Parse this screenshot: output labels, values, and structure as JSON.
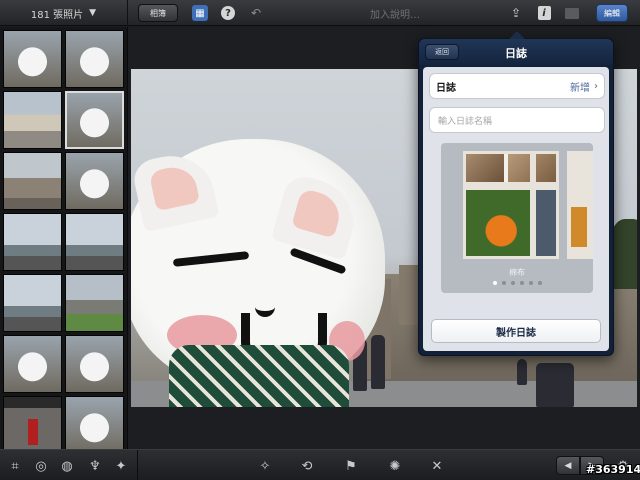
{
  "topbar": {
    "photo_count": "181 張照片",
    "count_arrow": "▼",
    "album_button": "相簿",
    "caption_placeholder": "加入說明…",
    "edit_button": "編輯",
    "icons": {
      "grid": "grid-icon",
      "help": "help-icon",
      "undo": "undo-icon",
      "share": "share-icon",
      "info": "info-icon",
      "compare": "compare-icon"
    },
    "glyphs": {
      "grid": "▦",
      "help": "?",
      "undo": "↶",
      "share": "⇪",
      "info": "i"
    }
  },
  "sidebar": {
    "thumbnails": [
      {
        "kind": "cat",
        "selected": false
      },
      {
        "kind": "cat",
        "selected": false
      },
      {
        "kind": "street",
        "selected": false
      },
      {
        "kind": "cat",
        "selected": true
      },
      {
        "kind": "castle",
        "selected": false
      },
      {
        "kind": "cat",
        "selected": false
      },
      {
        "kind": "towerbridge",
        "selected": false
      },
      {
        "kind": "towerbridge",
        "selected": false
      },
      {
        "kind": "towerbridge",
        "selected": false
      },
      {
        "kind": "green",
        "selected": false
      },
      {
        "kind": "cat",
        "selected": false
      },
      {
        "kind": "cat",
        "selected": false
      },
      {
        "kind": "guard",
        "selected": false
      },
      {
        "kind": "cat",
        "selected": false
      }
    ]
  },
  "journal_popover": {
    "back_button": "返回",
    "title": "日誌",
    "journal_row_label": "日誌",
    "journal_row_value": "新增",
    "journal_row_chevron": "›",
    "name_placeholder": "輸入日誌名稱",
    "theme_label": "棉布",
    "page_dots": 6,
    "active_dot": 0,
    "create_button": "製作日誌"
  },
  "bottom_toolbar": {
    "left_tools": [
      {
        "name": "crop-icon",
        "glyph": "⌗"
      },
      {
        "name": "color-icon",
        "glyph": "◎"
      },
      {
        "name": "palette-icon",
        "glyph": "◍"
      },
      {
        "name": "brush-icon",
        "glyph": "♆"
      },
      {
        "name": "effects-icon",
        "glyph": "✦"
      }
    ],
    "center_tools": [
      {
        "name": "auto-enhance-icon",
        "glyph": "✧"
      },
      {
        "name": "rotate-icon",
        "glyph": "⟲"
      },
      {
        "name": "flag-icon",
        "glyph": "⚑"
      },
      {
        "name": "star-icon",
        "glyph": "✺"
      },
      {
        "name": "hide-icon",
        "glyph": "✕"
      }
    ],
    "prev_glyph": "◀",
    "next_glyph": "▶",
    "settings_glyph": "⚙"
  },
  "watermark": "#363914",
  "colors": {
    "accent_blue": "#3f6fb6",
    "popover_navy": "#122138",
    "edit_button_blue": "#2f5a9e"
  }
}
